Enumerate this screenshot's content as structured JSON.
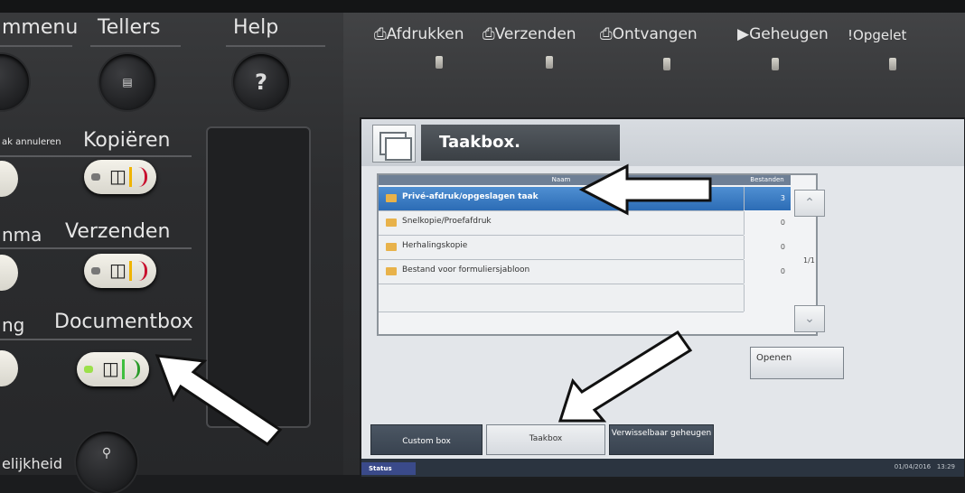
{
  "left_panel": {
    "top_labels": [
      "mmenu",
      "Tellers",
      "Help"
    ],
    "help_symbol": "?",
    "mode_labels": {
      "cancel": "ak annuleren",
      "copy": "Kopiëren",
      "program": "nma",
      "send": "Verzenden",
      "ng": "ng",
      "documentbox": "Documentbox",
      "accessibility": "elijkheid"
    }
  },
  "status_leds": {
    "labels": [
      "Afdrukken",
      "Verzenden",
      "Ontvangen",
      "Geheugen",
      "Opgelet"
    ],
    "icons": [
      "print-icon",
      "send-icon",
      "receive-icon",
      "memory-icon",
      "warning-icon"
    ]
  },
  "screen": {
    "title": "Taakbox.",
    "table": {
      "col_name": "Naam",
      "col_files": "Bestanden",
      "rows": [
        {
          "name": "Privé-afdruk/opgeslagen taak",
          "count": "3"
        },
        {
          "name": "Snelkopie/Proefafdruk",
          "count": "0"
        },
        {
          "name": "Herhalingskopie",
          "count": "0"
        },
        {
          "name": "Bestand voor formuliersjabloon",
          "count": "0"
        }
      ]
    },
    "page_indicator": "1/1",
    "open_button": "Openen",
    "tabs": [
      "Custom box",
      "Taakbox",
      "Verwisselbaar geheugen"
    ],
    "status": "Status",
    "date": "01/04/2016",
    "time": "13:29"
  },
  "colors": {
    "selected_row": "#3b7cc4",
    "lcd_bg": "#e3e6ea",
    "header_block": "#474c52"
  }
}
